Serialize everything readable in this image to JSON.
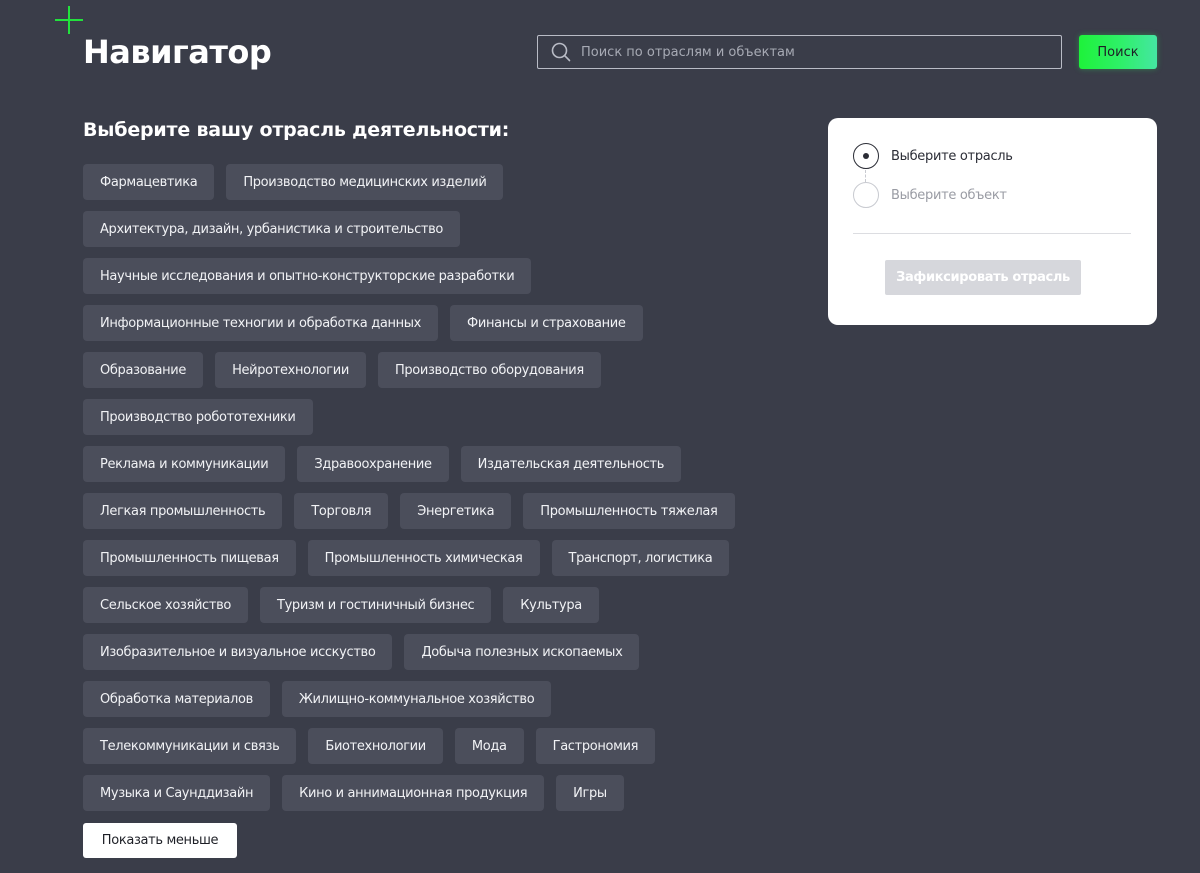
{
  "header": {
    "title": "Навигатор",
    "search_placeholder": "Поиск по отраслям и объектам",
    "search_button": "Поиск",
    "accent_color": "#22e23d"
  },
  "industries": {
    "heading": "Выберите вашу отрасль деятельности:",
    "rows": [
      [
        "Фармацевтика",
        "Производство медицинских изделий"
      ],
      [
        "Архитектура, дизайн, урбанистика и строительство"
      ],
      [
        "Научные исследования и опытно-конструкторские разработки"
      ],
      [
        "Информационные техногии и обработка данных",
        "Финансы и страхование"
      ],
      [
        "Образование",
        "Нейротехнологии",
        "Производство оборудования"
      ],
      [
        "Производство робототехники"
      ],
      [
        "Реклама и коммуникации",
        "Здравоохранение",
        "Издательская деятельность"
      ],
      [
        "Легкая промышленность",
        "Торговля",
        "Энергетика",
        "Промышленность тяжелая"
      ],
      [
        "Промышленность пищевая",
        "Промышленность химическая",
        "Транспорт, логистика"
      ],
      [
        "Сельское хозяйство",
        "Туризм и гостиничный бизнес",
        "Культура"
      ],
      [
        "Изобразительное и визуальное исскуство",
        "Добыча полезных ископаемых"
      ],
      [
        "Обработка материалов",
        "Жилищно-коммунальное хозяйство"
      ],
      [
        "Телекоммуникации и связь",
        "Биотехнологии",
        "Мода",
        "Гастрономия"
      ],
      [
        "Музыка и Саунддизайн",
        "Кино и аннимационная продукция",
        "Игры"
      ]
    ],
    "show_less": "Показать меньше"
  },
  "steps": {
    "step1": "Выберите отрасль",
    "step2": "Выберите объект",
    "fix_button": "Зафиксировать отрасль"
  }
}
